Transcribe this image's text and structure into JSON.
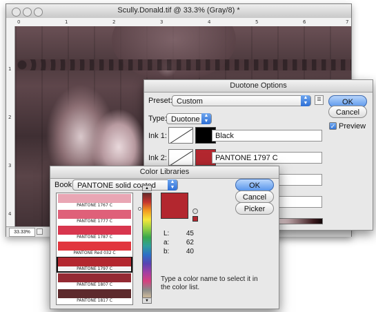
{
  "document": {
    "title": "Scully.Donald.tif @ 33.3% (Gray/8) *",
    "zoom": "33.33%",
    "ruler_top": [
      "0",
      "1",
      "2",
      "3",
      "4",
      "5",
      "6",
      "7"
    ],
    "ruler_left": [
      "1",
      "2",
      "3",
      "4"
    ]
  },
  "duotone": {
    "title": "Duotone Options",
    "preset_label": "Preset:",
    "preset_value": "Custom",
    "type_label": "Type:",
    "type_value": "Duotone",
    "ink1_label": "Ink 1:",
    "ink1_name": "Black",
    "ink1_color": "#000000",
    "ink2_label": "Ink 2:",
    "ink2_name": "PANTONE 1797 C",
    "ink2_color": "#b3272f",
    "ok": "OK",
    "cancel": "Cancel",
    "preview_label": "Preview",
    "preview_checked": true
  },
  "color_libraries": {
    "title": "Color Libraries",
    "book_label": "Book:",
    "book_value": "PANTONE solid coated",
    "ok": "OK",
    "cancel": "Cancel",
    "picker": "Picker",
    "swatches": [
      {
        "name": "PANTONE 1767 C",
        "color": "#e9a6b4",
        "selected": false
      },
      {
        "name": "PANTONE 1777 C",
        "color": "#df6079",
        "selected": false
      },
      {
        "name": "PANTONE 1787 C",
        "color": "#d8364e",
        "selected": false
      },
      {
        "name": "PANTONE Red 032 C",
        "color": "#e1363e",
        "selected": false
      },
      {
        "name": "PANTONE 1797 C",
        "color": "#b3272f",
        "selected": true
      },
      {
        "name": "PANTONE 1807 C",
        "color": "#942a33",
        "selected": false
      },
      {
        "name": "PANTONE 1817 C",
        "color": "#5d2a2c",
        "selected": false
      }
    ],
    "selected_color": "#b3272f",
    "lab": {
      "L_label": "L:",
      "L": "45",
      "a_label": "a:",
      "a": "62",
      "b_label": "b:",
      "b": "40"
    },
    "hint": "Type a color name to select it in the color list."
  }
}
